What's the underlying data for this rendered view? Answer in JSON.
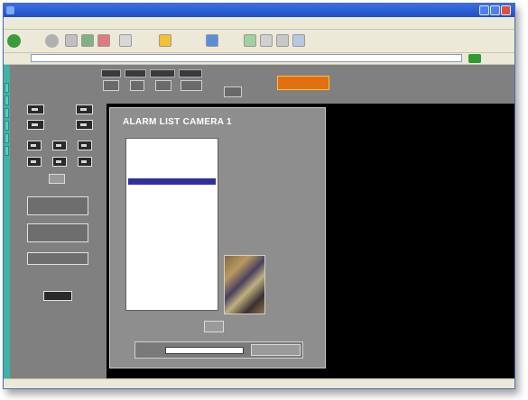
{
  "window": {
    "title": ""
  },
  "menu": {
    "items": [
      "",
      "",
      "",
      "",
      "",
      ""
    ]
  },
  "toolbar": {
    "back_label": "",
    "search_label": "",
    "favorites_label": "",
    "media_label": ""
  },
  "address": {
    "label": "",
    "url": "",
    "links_label": ""
  },
  "colors": {
    "background": "#808080",
    "sidebar_accent": "#3fb3a6",
    "selection": "#3030a0",
    "brand": "#e07010"
  },
  "icons": [
    "back-icon",
    "forward-icon",
    "stop-icon",
    "refresh-icon",
    "home-icon",
    "search-icon",
    "favorites-icon",
    "media-icon",
    "history-icon",
    "mail-icon",
    "print-icon",
    "edit-icon",
    "go-icon"
  ],
  "app": {
    "logo_text": "",
    "brand_logo": "",
    "header": {
      "labels": [
        "",
        "",
        "",
        ""
      ],
      "values": [
        "",
        "",
        "",
        "",
        ""
      ]
    },
    "controls": {
      "ptz_buttons": [
        "",
        "",
        "",
        "",
        "",
        "",
        "",
        "",
        "",
        ""
      ],
      "center_button": "",
      "button_1": "",
      "button_2": "",
      "button_3": "",
      "zoom_in": "",
      "zoom_out": "",
      "bottom_button": ""
    }
  },
  "dialog": {
    "title": "ALARM LIST CAMERA 1",
    "alarm_rows": [
      "",
      "",
      "",
      "",
      "",
      "",
      "",
      "",
      "",
      "",
      "",
      ""
    ],
    "selected_index": 6,
    "ok_label": "",
    "search_label": "",
    "search_value": "",
    "search_button_label": ""
  },
  "status": {
    "left": "",
    "right": ""
  }
}
